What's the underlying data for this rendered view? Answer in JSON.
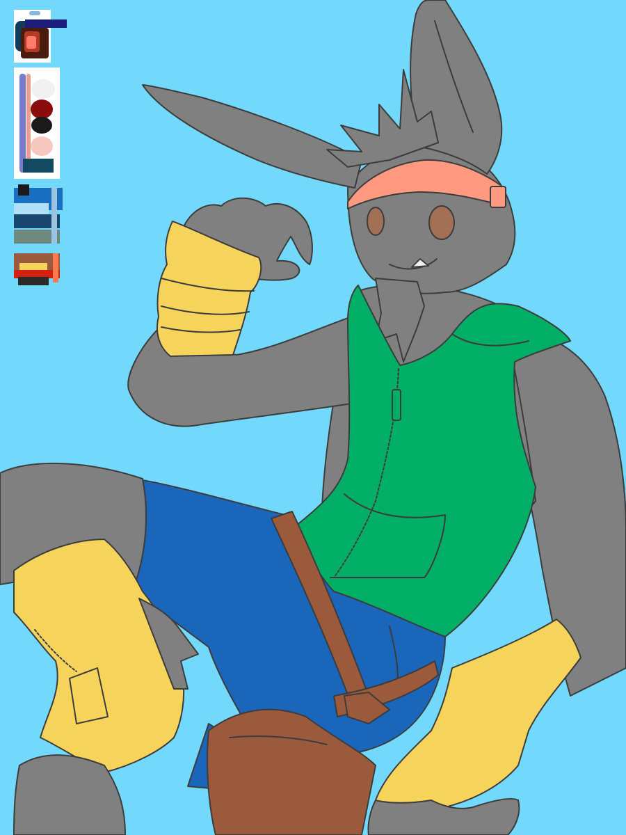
{
  "colors": {
    "background": "#72D9FD",
    "fur": "#808080",
    "lineart": "#3c3c3c",
    "visor": "#FF9A80",
    "vest": "#00AE66",
    "shorts": "#1A66BB",
    "wraps": "#F6D35A",
    "belt": "#9C5A3C",
    "eye": "#a27055"
  },
  "palette_swatches": [
    {
      "name": "palette-head",
      "colors": [
        "#123c5a",
        "#b33b26",
        "#4a1c0e",
        "#ff7a6a",
        "#1c1c7a",
        "#8ab8d8"
      ]
    },
    {
      "name": "palette-skin",
      "colors": [
        "#7a7acc",
        "#e8a090",
        "#f0f0f0",
        "#8a0c0c",
        "#1a1a1a",
        "#f6c8c0",
        "#124a62"
      ]
    },
    {
      "name": "palette-blues",
      "colors": [
        "#1a1a1a",
        "#1a6fc0",
        "#b0e0f8",
        "#18466e",
        "#6e8a80",
        "#9ac4e0"
      ]
    },
    {
      "name": "palette-browns",
      "colors": [
        "#9c5a3c",
        "#f6d35a",
        "#d02010",
        "#ff7a50",
        "#2a2a2a"
      ]
    }
  ]
}
